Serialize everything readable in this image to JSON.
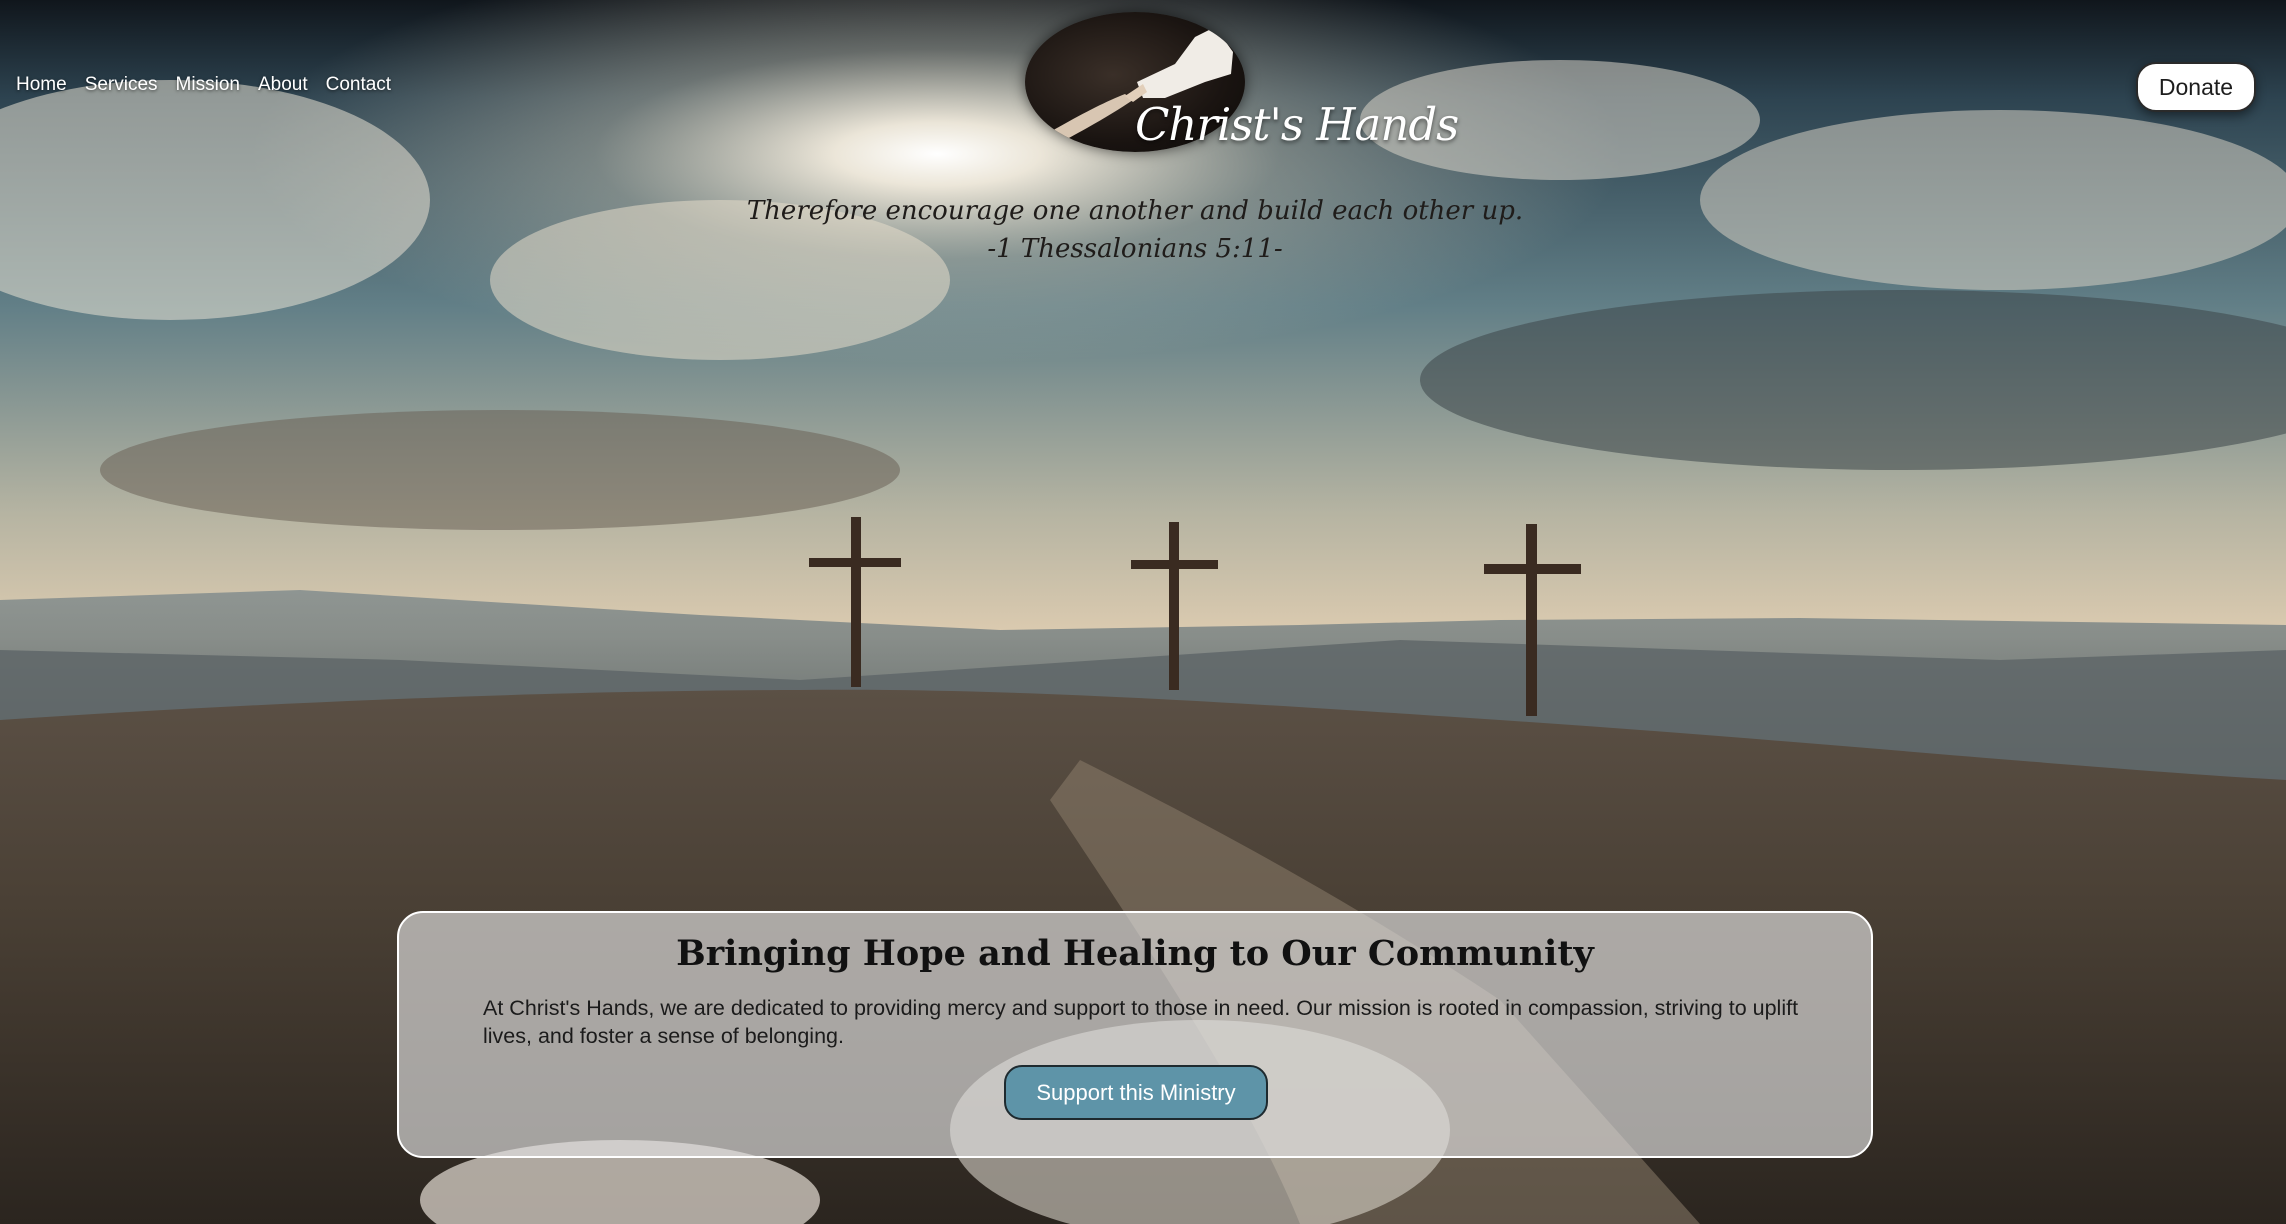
{
  "nav": {
    "items": [
      {
        "label": "Home"
      },
      {
        "label": "Services"
      },
      {
        "label": "Mission"
      },
      {
        "label": "About"
      },
      {
        "label": "Contact"
      }
    ]
  },
  "logo": {
    "text": "Christ's Hands"
  },
  "header": {
    "donate_label": "Donate"
  },
  "verse": {
    "text": "Therefore encourage one another and build each other up.",
    "reference": "-1 Thessalonians 5:11-"
  },
  "hero": {
    "title": "Bringing Hope and Healing to Our Community",
    "body": "At Christ's Hands, we are dedicated to providing mercy and support to those in need. Our mission is rooted in compassion, striving to uplift lives, and foster a sense of belonging.",
    "cta_label": "Support this Ministry"
  },
  "colors": {
    "cta_background": "#5e94a8",
    "card_background": "#e1e1e1",
    "donate_background": "#ffffff"
  },
  "background_image": "three-crosses-on-hill-at-sunrise"
}
